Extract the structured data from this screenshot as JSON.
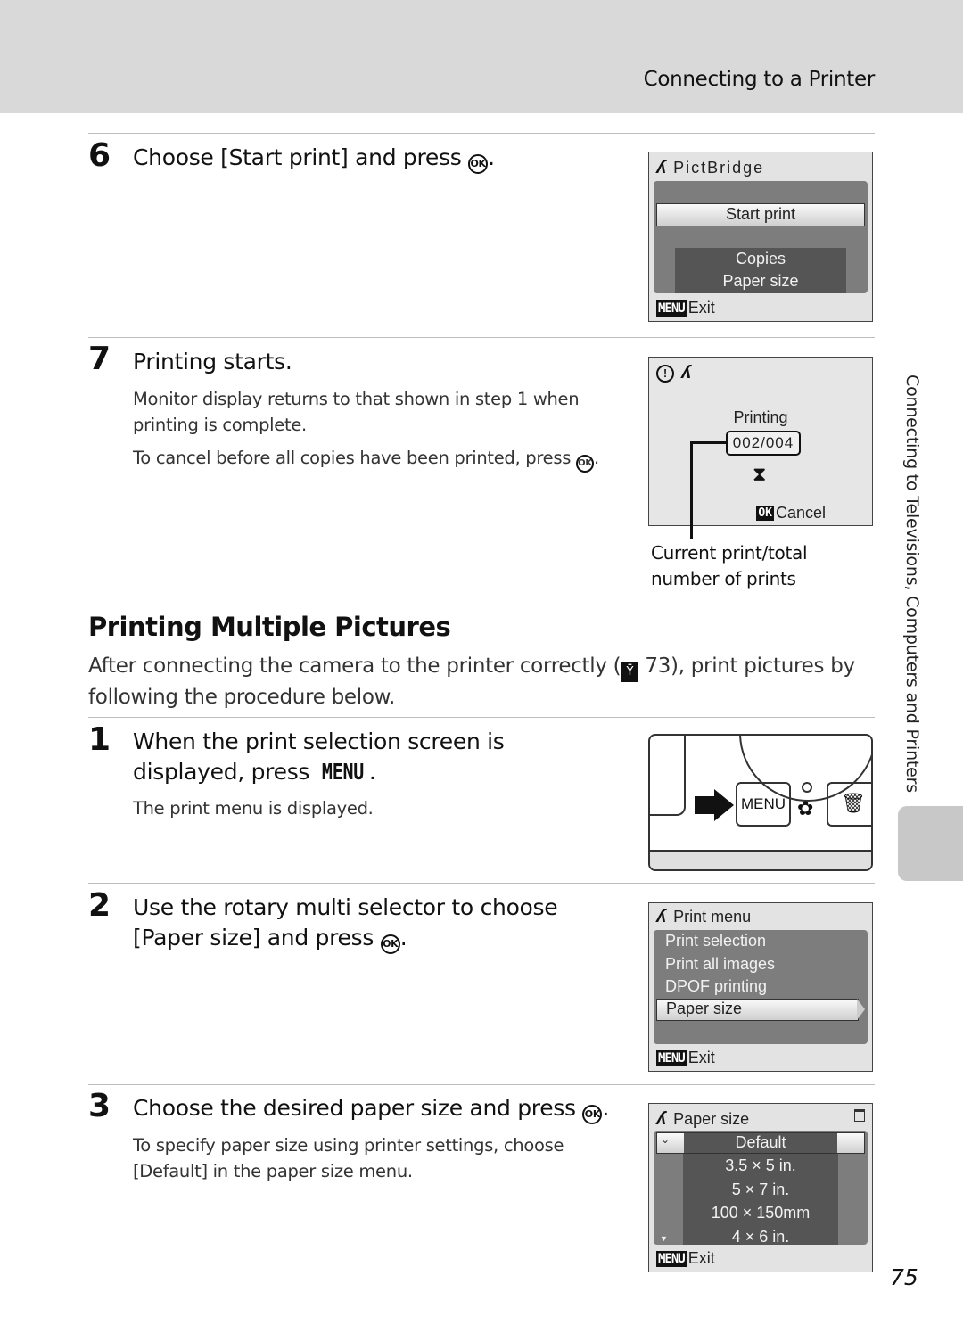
{
  "header": {
    "title": "Connecting to a Printer"
  },
  "side_tab": {
    "label": "Connecting to Televisions, Computers and Printers"
  },
  "page_number": "75",
  "step6": {
    "number": "6",
    "title_pre": "Choose [Start print] and press ",
    "title_post": ".",
    "ok_icon": "OK",
    "screen": {
      "header_icon": "pictbridge-icon",
      "header": "PictBridge",
      "selected_item": "Start print",
      "items": [
        "Copies",
        "Paper size"
      ],
      "menu_badge": "MENU",
      "exit_label": "Exit"
    }
  },
  "step7": {
    "number": "7",
    "title": "Printing starts.",
    "body1": "Monitor display returns to that shown in step 1 when printing is complete.",
    "body2_pre": "To cancel before all copies have been printed, press ",
    "body2_post": ".",
    "ok_icon": "OK",
    "screen": {
      "status_label": "Printing",
      "counter": "002/004",
      "ok_badge": "OK",
      "cancel_label": "Cancel"
    },
    "callout": "Current print/total number of prints"
  },
  "section": {
    "title": "Printing Multiple Pictures",
    "intro_pre": "After connecting the camera to the printer correctly (",
    "intro_ref_icon": "ref",
    "intro_post": " 73), print pictures by following the procedure below."
  },
  "step1": {
    "number": "1",
    "title_pre": "When the print selection screen is displayed, press ",
    "menu_word": "MENU",
    "title_post": ".",
    "body": "The print menu is displayed.",
    "camera": {
      "menu_button": "MENU"
    }
  },
  "step2": {
    "number": "2",
    "title_pre": "Use the rotary multi selector to choose [Paper size] and press ",
    "title_post": ".",
    "ok_icon": "OK",
    "screen": {
      "header": "Print menu",
      "items": [
        "Print selection",
        "Print all images",
        "DPOF printing"
      ],
      "selected_item": "Paper size",
      "menu_badge": "MENU",
      "exit_label": "Exit"
    }
  },
  "step3": {
    "number": "3",
    "title_pre": "Choose the desired paper size and press ",
    "title_post": ".",
    "ok_icon": "OK",
    "body": "To specify paper size using printer settings, choose [Default] in the paper size menu.",
    "screen": {
      "header": "Paper size",
      "selected_item": "Default",
      "items": [
        "3.5 × 5 in.",
        "5 × 7 in.",
        "100 × 150mm",
        "4 × 6 in."
      ],
      "menu_badge": "MENU",
      "exit_label": "Exit"
    }
  }
}
